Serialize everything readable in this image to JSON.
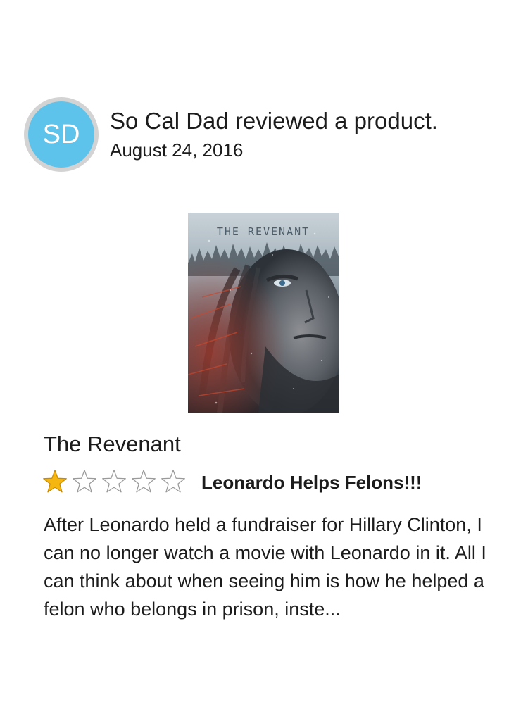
{
  "reviewer": {
    "initials": "SD",
    "activity": "So Cal Dad reviewed a product.",
    "date": "August 24, 2016",
    "avatar_color": "#5ec3ea",
    "avatar_ring_color": "#d3d3d3"
  },
  "product": {
    "poster_title": "THE REVENANT",
    "poster_icon": "movie-poster-image",
    "title": "The Revenant"
  },
  "review": {
    "rating": 1,
    "max_rating": 5,
    "star_fill_color": "#f5b70f",
    "star_outline_color": "#9a9a9a",
    "headline": "Leonardo Helps Felons!!!",
    "body": "After Leonardo held a fundraiser for Hillary Clinton, I can no longer watch a movie with Leonardo in it. All I can think about when seeing him is how he helped a felon who belongs in prison, inste..."
  }
}
